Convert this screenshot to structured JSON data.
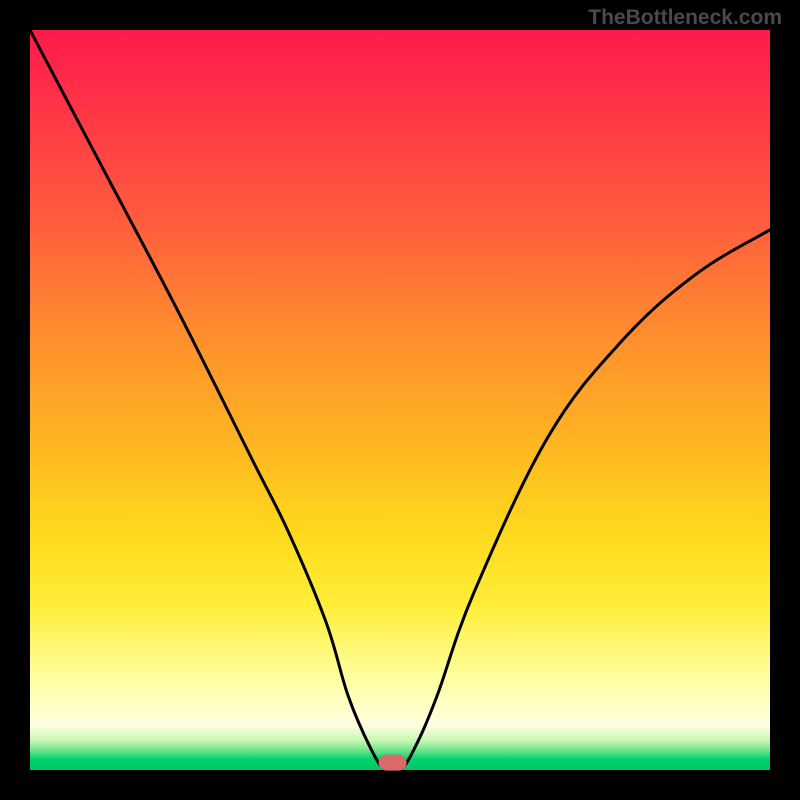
{
  "watermark": "TheBottleneck.com",
  "chart_data": {
    "type": "line",
    "title": "",
    "xlabel": "",
    "ylabel": "",
    "xlim": [
      0,
      100
    ],
    "ylim": [
      0,
      100
    ],
    "series": [
      {
        "name": "bottleneck-curve",
        "x": [
          0,
          10,
          20,
          30,
          35,
          40,
          43,
          46,
          48,
          50,
          52,
          55,
          60,
          70,
          80,
          90,
          100
        ],
        "values": [
          100,
          81,
          62,
          42,
          32,
          20,
          10,
          3,
          0,
          0,
          3,
          10,
          24,
          45,
          58,
          67,
          73
        ]
      }
    ],
    "marker": {
      "name": "optimal-point",
      "x": 49,
      "y": 1,
      "color": "#d86a6a"
    },
    "colors": {
      "curve": "#000000",
      "marker": "#d86a6a",
      "gradient_top": "#ff1a4b",
      "gradient_mid": "#ffd91d",
      "gradient_bottom": "#00c765",
      "frame": "#000000"
    }
  }
}
